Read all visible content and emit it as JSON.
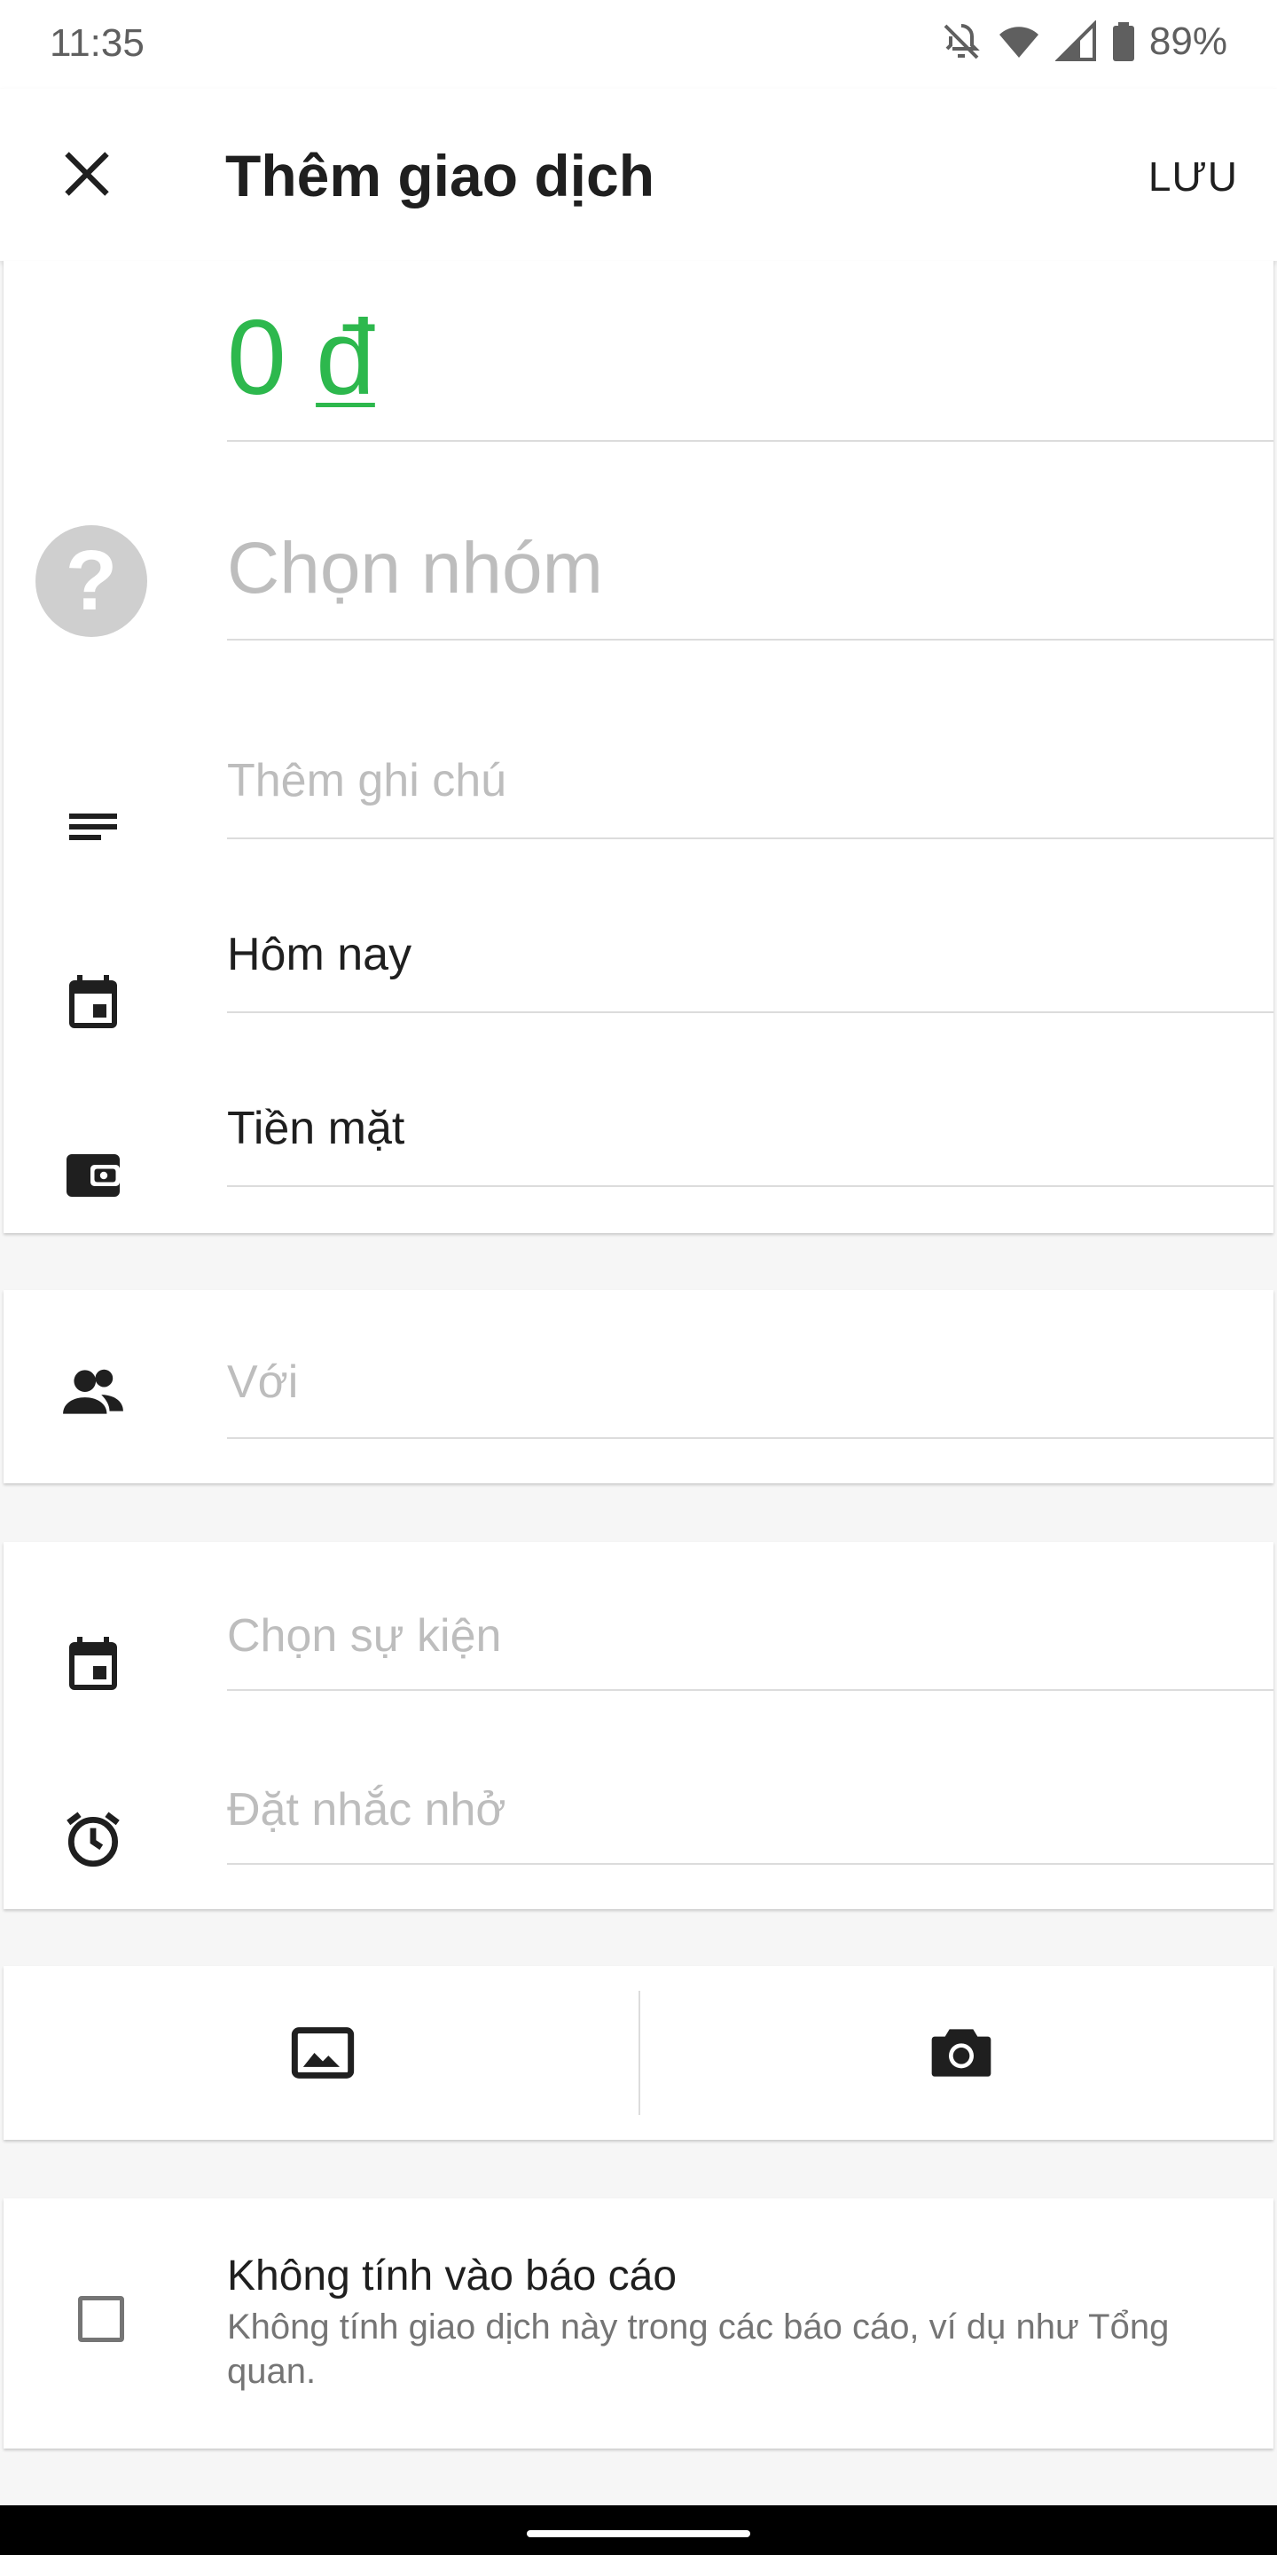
{
  "status_bar": {
    "time": "11:35",
    "battery": "89%"
  },
  "app_bar": {
    "title": "Thêm giao dịch",
    "save_label": "LƯU"
  },
  "amount": {
    "value": "0",
    "currency": "đ",
    "color": "#2db84d"
  },
  "group": {
    "placeholder": "Chọn nhóm",
    "icon": "?"
  },
  "note": {
    "placeholder": "Thêm ghi chú"
  },
  "date": {
    "value": "Hôm nay"
  },
  "wallet": {
    "value": "Tiền mặt"
  },
  "with": {
    "placeholder": "Với"
  },
  "event": {
    "placeholder": "Chọn sự kiện"
  },
  "reminder": {
    "placeholder": "Đặt nhắc nhở"
  },
  "exclude": {
    "title": "Không tính vào báo cáo",
    "description": "Không tính giao dịch này trong các báo cáo, ví dụ như Tổng quan."
  }
}
